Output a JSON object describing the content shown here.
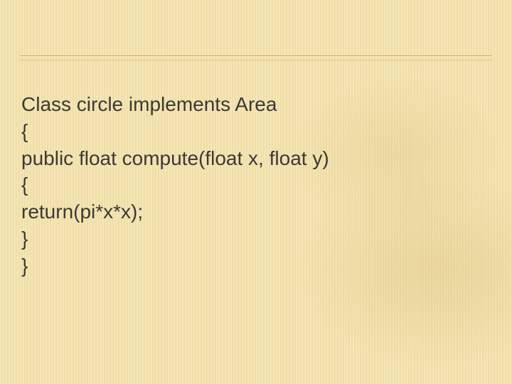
{
  "code": {
    "lines": [
      "Class circle implements Area",
      "{",
      "public float compute(float x, float y)",
      "{",
      "return(pi*x*x);",
      "}",
      "}"
    ]
  }
}
